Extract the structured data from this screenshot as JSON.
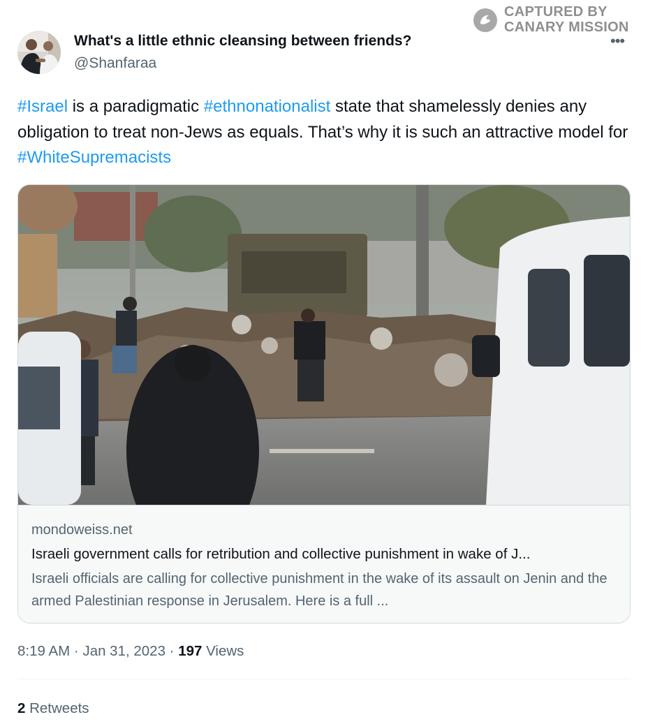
{
  "watermark": {
    "line1": "CAPTURED BY",
    "line2": "CANARY MISSION",
    "icon": "canary-bird-icon"
  },
  "tweet": {
    "author_name": "What's a little ethnic cleansing between friends?",
    "handle": "@Shanfaraa",
    "more_icon": "more-dots-icon",
    "text": {
      "hashtag_israel": "#Israel",
      "part1": " is a paradigmatic ",
      "hashtag_ethno": "#ethnonationalist",
      "part2": " state that shamelessly denies any obligation to treat non-Jews as equals. That’s why it is such an attractive model for ",
      "hashtag_white": "#WhiteSupremacists"
    },
    "time": "8:19 AM",
    "sep1": " · ",
    "date": "Jan 31, 2023",
    "sep2": " · ",
    "views_count": "197",
    "views_label": " Views",
    "retweets_count": "2",
    "retweets_label": " Retweets"
  },
  "card": {
    "domain": "mondoweiss.net",
    "title": "Israeli government calls for retribution and collective punishment in wake of J...",
    "description": "Israeli officials are calling for collective punishment in the wake of its assault on Jenin and the armed Palestinian response in Jerusalem. Here is a full ..."
  },
  "colors": {
    "link": "#1d9bf0",
    "secondary_text": "#536471",
    "primary_text": "#0f1419"
  }
}
